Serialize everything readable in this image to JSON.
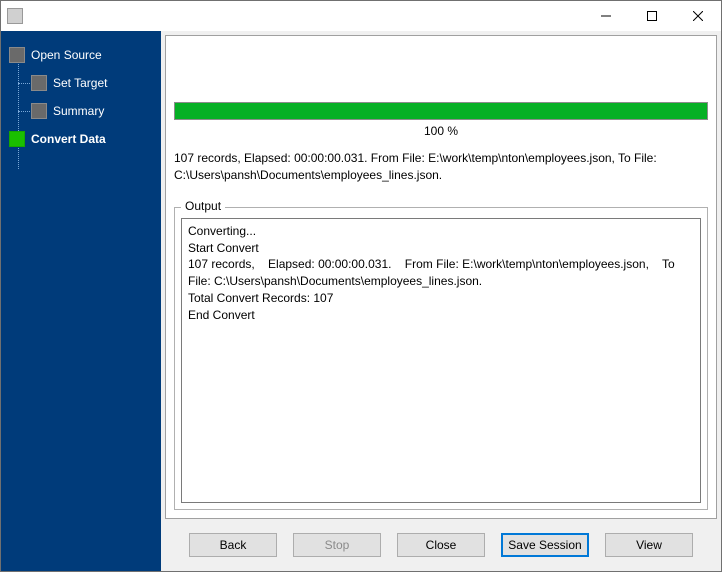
{
  "window": {
    "title": ""
  },
  "sidebar": {
    "items": [
      {
        "label": "Open Source",
        "active": false,
        "child": false
      },
      {
        "label": "Set Target",
        "active": false,
        "child": true
      },
      {
        "label": "Summary",
        "active": false,
        "child": true
      },
      {
        "label": "Convert Data",
        "active": true,
        "child": false
      }
    ]
  },
  "progress": {
    "percent": 100,
    "label": "100 %"
  },
  "status": "107 records,    Elapsed: 00:00:00.031.    From File: E:\\work\\temp\\nton\\employees.json,    To File: C:\\Users\\pansh\\Documents\\employees_lines.json.",
  "output": {
    "title": "Output",
    "lines": [
      "Converting...",
      "Start Convert",
      "107 records,    Elapsed: 00:00:00.031.    From File: E:\\work\\temp\\nton\\employees.json,    To File: C:\\Users\\pansh\\Documents\\employees_lines.json.",
      "Total Convert Records: 107",
      "End Convert"
    ]
  },
  "buttons": {
    "back": "Back",
    "stop": "Stop",
    "close": "Close",
    "save_session": "Save Session",
    "view": "View"
  }
}
